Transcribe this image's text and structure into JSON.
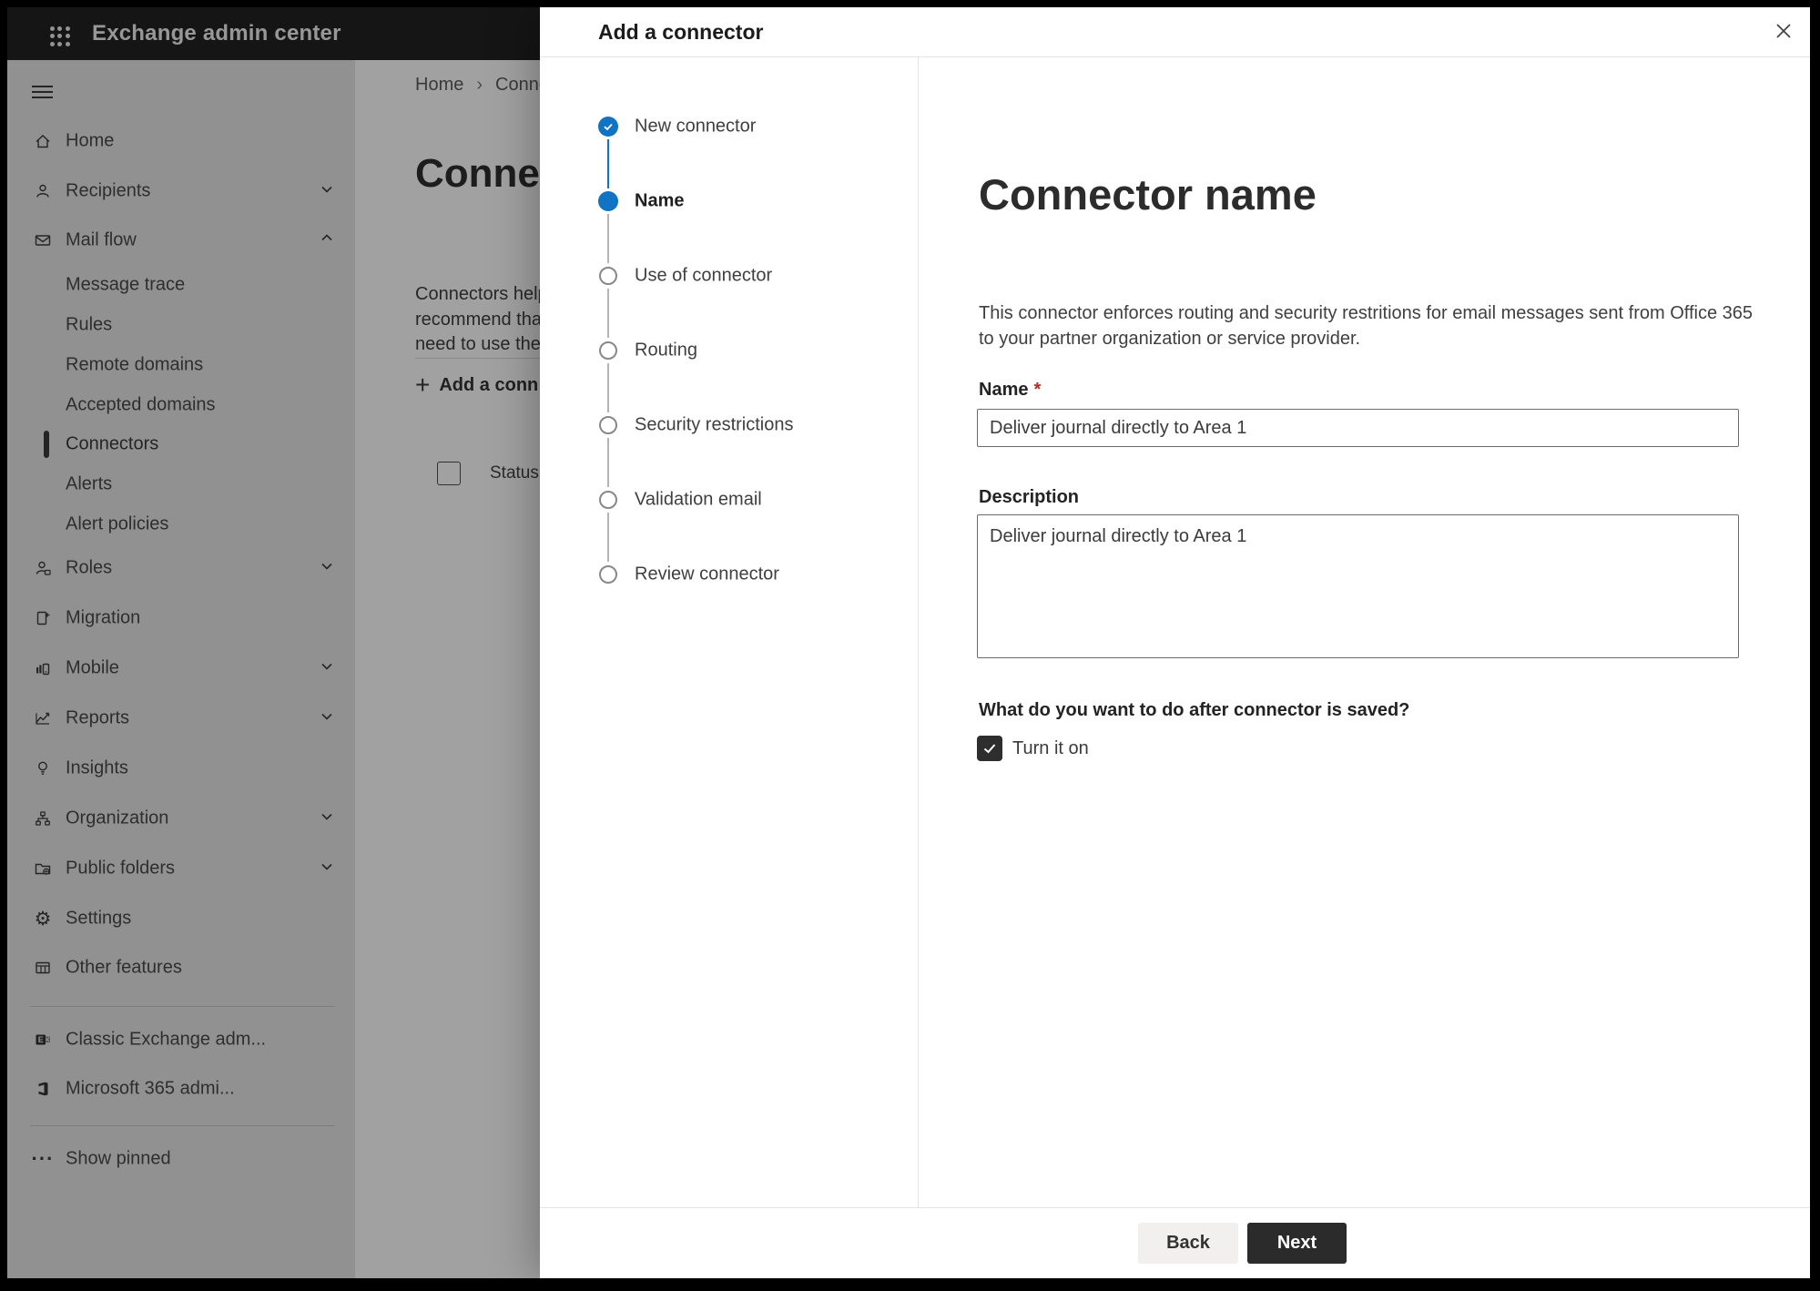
{
  "header": {
    "app_title": "Exchange admin center"
  },
  "sidebar": {
    "items": [
      {
        "label": "Home"
      },
      {
        "label": "Recipients"
      },
      {
        "label": "Mail flow"
      },
      {
        "label": "Message trace"
      },
      {
        "label": "Rules"
      },
      {
        "label": "Remote domains"
      },
      {
        "label": "Accepted domains"
      },
      {
        "label": "Connectors",
        "selected": true
      },
      {
        "label": "Alerts"
      },
      {
        "label": "Alert policies"
      },
      {
        "label": "Roles"
      },
      {
        "label": "Migration"
      },
      {
        "label": "Mobile"
      },
      {
        "label": "Reports"
      },
      {
        "label": "Insights"
      },
      {
        "label": "Organization"
      },
      {
        "label": "Public folders"
      },
      {
        "label": "Settings"
      },
      {
        "label": "Other features"
      },
      {
        "label": "Classic Exchange adm..."
      },
      {
        "label": "Microsoft 365 admi..."
      },
      {
        "label": "Show pinned"
      }
    ]
  },
  "background": {
    "breadcrumb": {
      "home": "Home",
      "separator": "›",
      "current": "Conne"
    },
    "page_title": "Connec",
    "intro_lines": [
      "Connectors help",
      "recommend that",
      "need to use ther"
    ],
    "add_button_label": "Add a conn",
    "table": {
      "status_header": "Status"
    }
  },
  "dialog": {
    "title": "Add a connector",
    "steps": [
      {
        "label": "New connector",
        "state": "completed"
      },
      {
        "label": "Name",
        "state": "current"
      },
      {
        "label": "Use of connector",
        "state": "upcoming"
      },
      {
        "label": "Routing",
        "state": "upcoming"
      },
      {
        "label": "Security restrictions",
        "state": "upcoming"
      },
      {
        "label": "Validation email",
        "state": "upcoming"
      },
      {
        "label": "Review connector",
        "state": "upcoming"
      }
    ],
    "content": {
      "heading": "Connector name",
      "intro_line1": "This connector enforces routing and security restritions for email messages sent from Office 365",
      "intro_line2": "to your partner organization or service provider.",
      "name_label": "Name",
      "required_marker": "*",
      "name_value": "Deliver journal directly to Area 1",
      "description_label": "Description",
      "description_value": "Deliver journal directly to Area 1",
      "after_save_question": "What do you want to do after connector is saved?",
      "turn_it_on_label": "Turn it on",
      "turn_it_on_checked": true
    },
    "footer": {
      "back_label": "Back",
      "next_label": "Next"
    }
  },
  "colors": {
    "accent_blue": "#1173c4",
    "header_bg": "#222222",
    "sidebar_bg": "#e6e6e6",
    "required_red": "#b52b27",
    "next_button_bg": "#2b2b2b",
    "back_button_bg": "#f1f0ee",
    "overlay": "rgba(0,0,0,0.37)"
  }
}
